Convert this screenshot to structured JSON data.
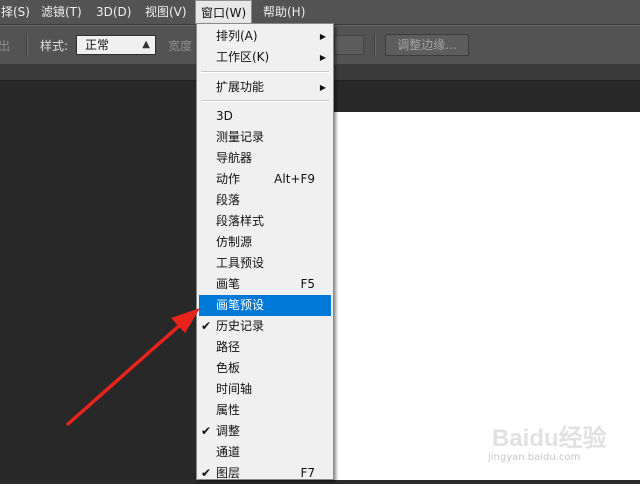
{
  "menubar": {
    "items": [
      {
        "label": "择(S)"
      },
      {
        "label": "滤镜(T)"
      },
      {
        "label": "3D(D)"
      },
      {
        "label": "视图(V)"
      },
      {
        "label": "窗口(W)"
      },
      {
        "label": "帮助(H)"
      }
    ]
  },
  "options": {
    "clipped_text": "出",
    "style_label": "样式:",
    "style_value": "正常",
    "width_label": "宽度",
    "refine_edge": "调整边缘..."
  },
  "window_menu": {
    "items": [
      {
        "label": "排列(A)",
        "submenu": true
      },
      {
        "label": "工作区(K)",
        "submenu": true
      },
      {
        "label": "扩展功能",
        "submenu": true
      },
      {
        "label": "3D"
      },
      {
        "label": "测量记录"
      },
      {
        "label": "导航器"
      },
      {
        "label": "动作",
        "shortcut": "Alt+F9"
      },
      {
        "label": "段落"
      },
      {
        "label": "段落样式"
      },
      {
        "label": "仿制源"
      },
      {
        "label": "工具预设"
      },
      {
        "label": "画笔",
        "shortcut": "F5"
      },
      {
        "label": "画笔预设",
        "highlighted": true
      },
      {
        "label": "历史记录",
        "checked": true
      },
      {
        "label": "路径"
      },
      {
        "label": "色板"
      },
      {
        "label": "时间轴"
      },
      {
        "label": "属性"
      },
      {
        "label": "调整",
        "checked": true
      },
      {
        "label": "通道"
      },
      {
        "label": "图层",
        "checked": true,
        "shortcut": "F7"
      }
    ]
  },
  "watermark": {
    "brand": "Baidu经验",
    "url": "jingyan.baidu.com"
  },
  "colors": {
    "highlight": "#0078d7",
    "annotation_arrow": "#e8231c"
  }
}
